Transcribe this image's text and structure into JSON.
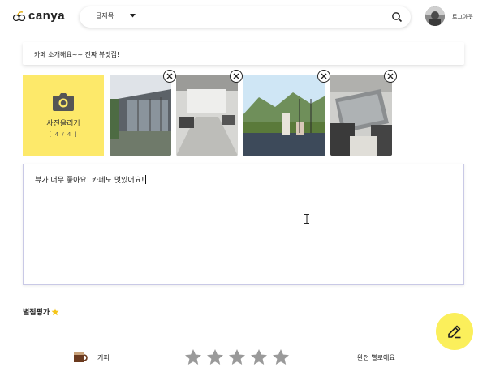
{
  "header": {
    "logo_text": "canya",
    "search": {
      "selected_option": "글제목",
      "value": ""
    },
    "logout_label": "로그아웃"
  },
  "post": {
    "title": "카페 소개해요~~ 진짜 뷰맛집!",
    "upload": {
      "label": "사진올리기",
      "count": "[ 4 / 4 ]"
    },
    "photos": [
      {
        "alt": "cafe-exterior-photo"
      },
      {
        "alt": "cafe-interior-photo"
      },
      {
        "alt": "cafe-view-drinks-photo"
      },
      {
        "alt": "cafe-terrace-photo"
      }
    ],
    "review_text": "뷰가 너무 좋아요! 카페도 멋있어요!"
  },
  "rating": {
    "title": "별점평가",
    "category": "커피",
    "stars_total": 5,
    "stars_selected": 0,
    "description": "완전 별로에요"
  },
  "colors": {
    "accent_yellow": "#fde96a",
    "fab_yellow": "#fbef5b",
    "star_grey": "#9a9a9a"
  }
}
